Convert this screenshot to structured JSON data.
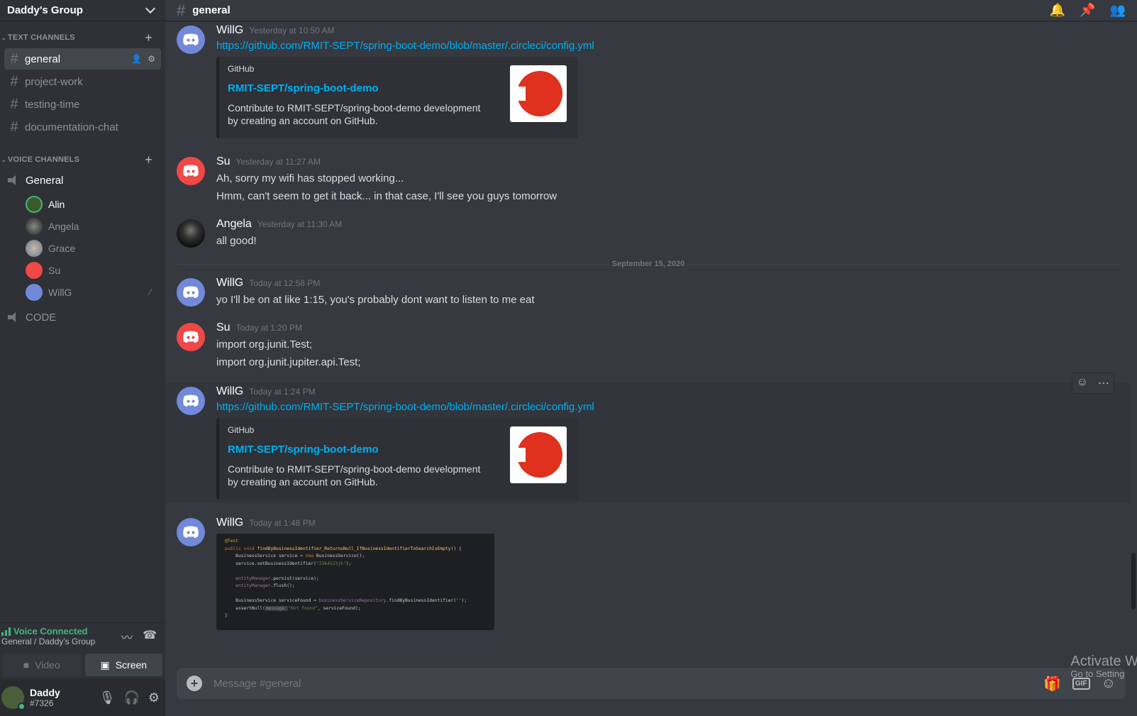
{
  "guild": {
    "name": "Daddy's Group"
  },
  "text_channels": {
    "header": "TEXT CHANNELS",
    "items": [
      {
        "label": "general"
      },
      {
        "label": "project-work"
      },
      {
        "label": "testing-time"
      },
      {
        "label": "documentation-chat"
      }
    ]
  },
  "voice_channels": {
    "header": "VOICE CHANNELS",
    "items": [
      {
        "label": "General"
      },
      {
        "label": "CODE"
      }
    ],
    "members": [
      {
        "name": "Alin"
      },
      {
        "name": "Angela"
      },
      {
        "name": "Grace"
      },
      {
        "name": "Su"
      },
      {
        "name": "WillG"
      }
    ]
  },
  "voice_panel": {
    "status": "Voice Connected",
    "location": "General / Daddy's Group",
    "video_label": "Video",
    "screen_label": "Screen"
  },
  "user": {
    "name": "Daddy",
    "tag": "#7326"
  },
  "channel": {
    "title": "general"
  },
  "messages": [
    {
      "author": "WillG",
      "time": "Yesterday at 10:50 AM",
      "link": "https://github.com/RMIT-SEPT/spring-boot-demo/blob/master/.circleci/config.yml",
      "embed": {
        "provider": "GitHub",
        "title": "RMIT-SEPT/spring-boot-demo",
        "desc": "Contribute to RMIT-SEPT/spring-boot-demo development by creating an account on GitHub."
      }
    },
    {
      "author": "Su",
      "time": "Yesterday at 11:27 AM",
      "lines": [
        "Ah, sorry my wifi has stopped working...",
        "Hmm, can't seem to get it back... in that case, I'll see you guys tomorrow"
      ]
    },
    {
      "author": "Angela",
      "time": "Yesterday at 11:30 AM",
      "lines": [
        "all good!"
      ]
    },
    {
      "author": "WillG",
      "time": "Today at 12:58 PM",
      "lines": [
        "yo I'll be on at like 1:15, you's probably dont want to listen to me eat"
      ]
    },
    {
      "author": "Su",
      "time": "Today at 1:20 PM",
      "lines": [
        "import org.junit.Test;",
        "import org.junit.jupiter.api.Test;"
      ]
    },
    {
      "author": "WillG",
      "time": "Today at 1:24 PM",
      "link": "https://github.com/RMIT-SEPT/spring-boot-demo/blob/master/.circleci/config.yml",
      "embed": {
        "provider": "GitHub",
        "title": "RMIT-SEPT/spring-boot-demo",
        "desc": "Contribute to RMIT-SEPT/spring-boot-demo development by creating an account on GitHub."
      }
    },
    {
      "author": "WillG",
      "time": "Today at 1:48 PM"
    }
  ],
  "date_divider": "September 15, 2020",
  "code_image": {
    "l1": "@Test",
    "l2a": "public void ",
    "l2b": "findByBusinessIdentifier_ReturnsNull_IfBusinessIdentifierToSearchIsEmpty",
    "l2c": "() {",
    "l3a": "    BusinessService service = ",
    "l3b": "new ",
    "l3c": "BusinessService();",
    "l4a": "    service.setBusinessIdentifier(",
    "l4b": "\"23k4523jh\"",
    "l4c": ");",
    "l5a": "    entityManager",
    "l5b": ".persist(service);",
    "l6a": "    entityManager",
    "l6b": ".flush();",
    "l7a": "    BusinessService serviceFound = ",
    "l7b": "businessServiceRepository",
    "l7c": ".findByBusinessIdentifier(",
    "l7d": "\"\"",
    "l7e": ");",
    "l8a": "    assertNull(",
    "l8b": "message:",
    "l8c": "\"Not found\"",
    "l8d": ", serviceFound);",
    "l9": "}"
  },
  "composer": {
    "placeholder": "Message #general"
  },
  "watermark": {
    "line1": "Activate W",
    "line2": "Go to Setting"
  },
  "colors": {
    "blurple": "#7289da",
    "red": "#f04747",
    "link": "#00b0f4",
    "green": "#43b581"
  }
}
